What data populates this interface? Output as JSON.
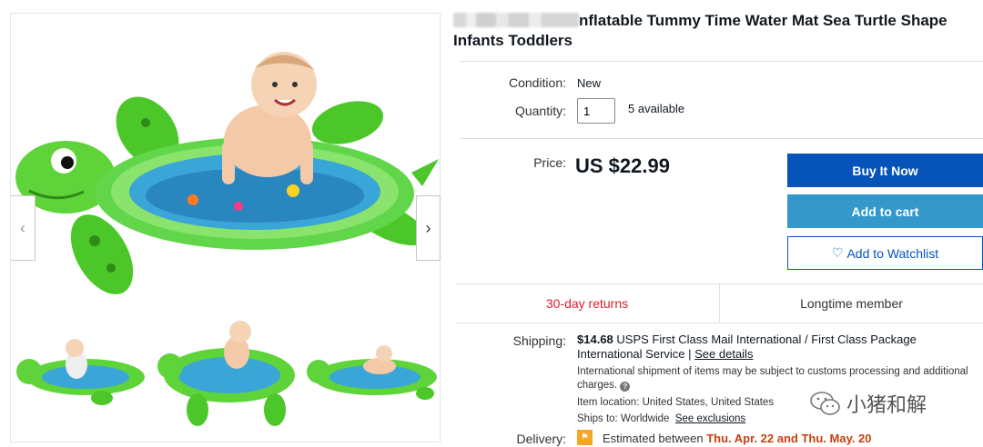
{
  "title": {
    "visible_text": "nflatable Tummy Time Water Mat Sea Turtle Shape",
    "line2": "Infants Toddlers"
  },
  "condition": {
    "label": "Condition:",
    "value": "New"
  },
  "quantity": {
    "label": "Quantity:",
    "value": "1",
    "available": "5 available"
  },
  "price": {
    "label": "Price:",
    "value": "US $22.99"
  },
  "buttons": {
    "buy_now": "Buy It Now",
    "add_to_cart": "Add to cart",
    "watchlist": "Add to Watchlist"
  },
  "badges": {
    "returns": "30-day returns",
    "member": "Longtime member"
  },
  "shipping": {
    "label": "Shipping:",
    "cost": "$14.68",
    "service": "USPS First Class Mail International / First Class Package International Service",
    "see_details": "See details",
    "note": "International shipment of items may be subject to customs processing and additional charges.",
    "location_label": "Item location:",
    "location": "United States, United States",
    "ships_to_label": "Ships to:",
    "ships_to": "Worldwide",
    "see_exclusions": "See exclusions"
  },
  "delivery": {
    "label": "Delivery:",
    "prefix": "Estimated between",
    "range": "Thu. Apr. 22 and Thu. May. 20"
  },
  "watermark": "小猪和解",
  "colors": {
    "buy_now": "#0654ba",
    "add_to_cart": "#3498ca",
    "returns": "#dd1e31",
    "delivery_date": "#c7400e",
    "mat_green": "#5fd43a"
  },
  "icons": [
    "chevron-left-icon",
    "chevron-right-icon",
    "heart-icon",
    "info-icon",
    "flag-icon",
    "wechat-icon"
  ]
}
